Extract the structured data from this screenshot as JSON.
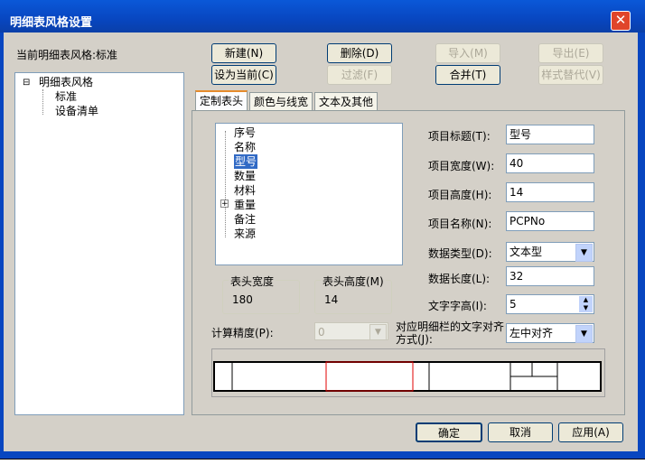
{
  "window": {
    "title": "明细表风格设置",
    "close": "✕"
  },
  "current_style": {
    "label": "当前明细表风格:",
    "value": "标准"
  },
  "tree": {
    "root": "明细表风格",
    "children": [
      "标准",
      "设备清单"
    ],
    "expander": "⊟"
  },
  "buttons": {
    "new": "新建(N)",
    "delete": "删除(D)",
    "import": "导入(M)",
    "export": "导出(E)",
    "set_current": "设为当前(C)",
    "filter": "过滤(F)",
    "merge": "合并(T)",
    "style_replace": "样式替代(V)",
    "ok": "确定",
    "cancel": "取消",
    "apply": "应用(A)"
  },
  "tabs": [
    "定制表头",
    "颜色与线宽",
    "文本及其他"
  ],
  "items": [
    "序号",
    "名称",
    "型号",
    "数量",
    "材料",
    "重量",
    "备注",
    "来源"
  ],
  "header_width": {
    "label": "表头宽度",
    "value": "180"
  },
  "header_height": {
    "label": "表头高度(M)",
    "value": "14"
  },
  "precision": {
    "label": "计算精度(P):",
    "value": "0"
  },
  "fields": {
    "title": {
      "label": "项目标题(T):",
      "value": "型号"
    },
    "width": {
      "label": "项目宽度(W):",
      "value": "40"
    },
    "height": {
      "label": "项目高度(H):",
      "value": "14"
    },
    "name": {
      "label": "项目名称(N):",
      "value": "PCPNo"
    },
    "data_type": {
      "label": "数据类型(D):",
      "value": "文本型"
    },
    "data_length": {
      "label": "数据长度(L):",
      "value": "32"
    },
    "char_height": {
      "label": "文字字高(I):",
      "value": "5"
    },
    "align_label1": "对应明细栏的文字对齐",
    "align_label2": "方式(J):",
    "align_value": "左中对齐"
  }
}
